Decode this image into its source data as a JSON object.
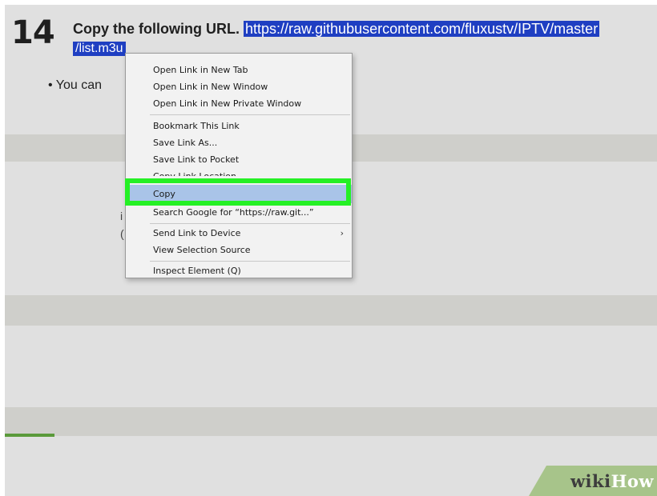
{
  "step": {
    "number": "14",
    "title": "Copy the following URL.",
    "url_part1": "https://raw.githubusercontent.com/fluxustv/IPTV/master",
    "url_part2": "/list.m3u",
    "bullet": "You can"
  },
  "obscured_chars": [
    "i",
    "("
  ],
  "context_menu": {
    "items": [
      "Open Link in New Tab",
      "Open Link in New Window",
      "Open Link in New Private Window",
      "Bookmark This Link",
      "Save Link As...",
      "Save Link to Pocket",
      "Copy Link Location",
      "Copy",
      "Search Google for “https://raw.git...”",
      "Send Link to Device",
      "View Selection Source",
      "Inspect Element (Q)"
    ],
    "submenu_arrow": "›",
    "highlighted": "Copy"
  },
  "watermark": {
    "part1": "wiki",
    "part2": "How"
  },
  "colors": {
    "selection": "#1f3fc2",
    "highlight_box": "#25f025",
    "menu_hover": "#a9c4e8",
    "background": "#e0e0e0",
    "band": "#cfcfcb"
  }
}
